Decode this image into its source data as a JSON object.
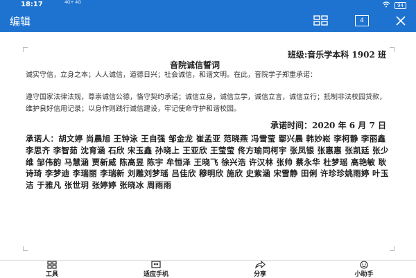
{
  "statusbar": {
    "time": "18:17",
    "network": "4G+ 4G",
    "battery": "94"
  },
  "appbar": {
    "title": "编辑",
    "page_count": "4"
  },
  "document": {
    "class_line": "班级:音乐学本科 1902 班",
    "title": "音院诚信誓词",
    "paragraph1": "诚实守信，立身之本；人人诚信，道德日兴；社会诚信，和谐文明。在此，音院学子郑重承诺：",
    "paragraph2": "遵守国家法律法规，尊崇诚信公德，恪守契约承诺；诚信立身，诚信立学，诚信立言，诚信立行；抵制非法校园贷款，维护良好信用记录；以身作则践行诚信建设，牢记使命守护和谐校园。",
    "date_line": "承诺时间：2020 年 6 月 7 日",
    "signers": "承诺人：胡文婷 尚晨旭 王钟泳 王自强 邹金龙 崔孟亚 范晓燕 冯雪莹 鄢兴晨 韩妙崧 李柯静 李丽鑫 李思齐 李智茹 沈育涵 石欣 宋玉鑫 孙晓上 王亚欣 王莹莹 佟方瑜同柯宇 张凤银 张惠惠 张凯廷 张少维 邹伟韵 马慧涵 贾新威 陈高昱 陈宇 牟恒泽 王晓飞 徐兴浩 许汉林 张帅 蔡永华 杜梦瑶 高艳敏 耿诗琦 李梦迪 李瑞丽 李瑞新 刘雕刘梦瑶 吕佳欣 穆明欣 施欣 史紫涵 宋雪静 田俐 许珍珍姚雨婷 叶玉洁 于雅凡 张世玥 张婷婷 张晓冰 周雨雨"
  },
  "bottomnav": {
    "tools": "工具",
    "fit_phone": "适应手机",
    "share": "分享",
    "assistant": "小助手"
  },
  "colors": {
    "accent": "#1e73d0"
  }
}
